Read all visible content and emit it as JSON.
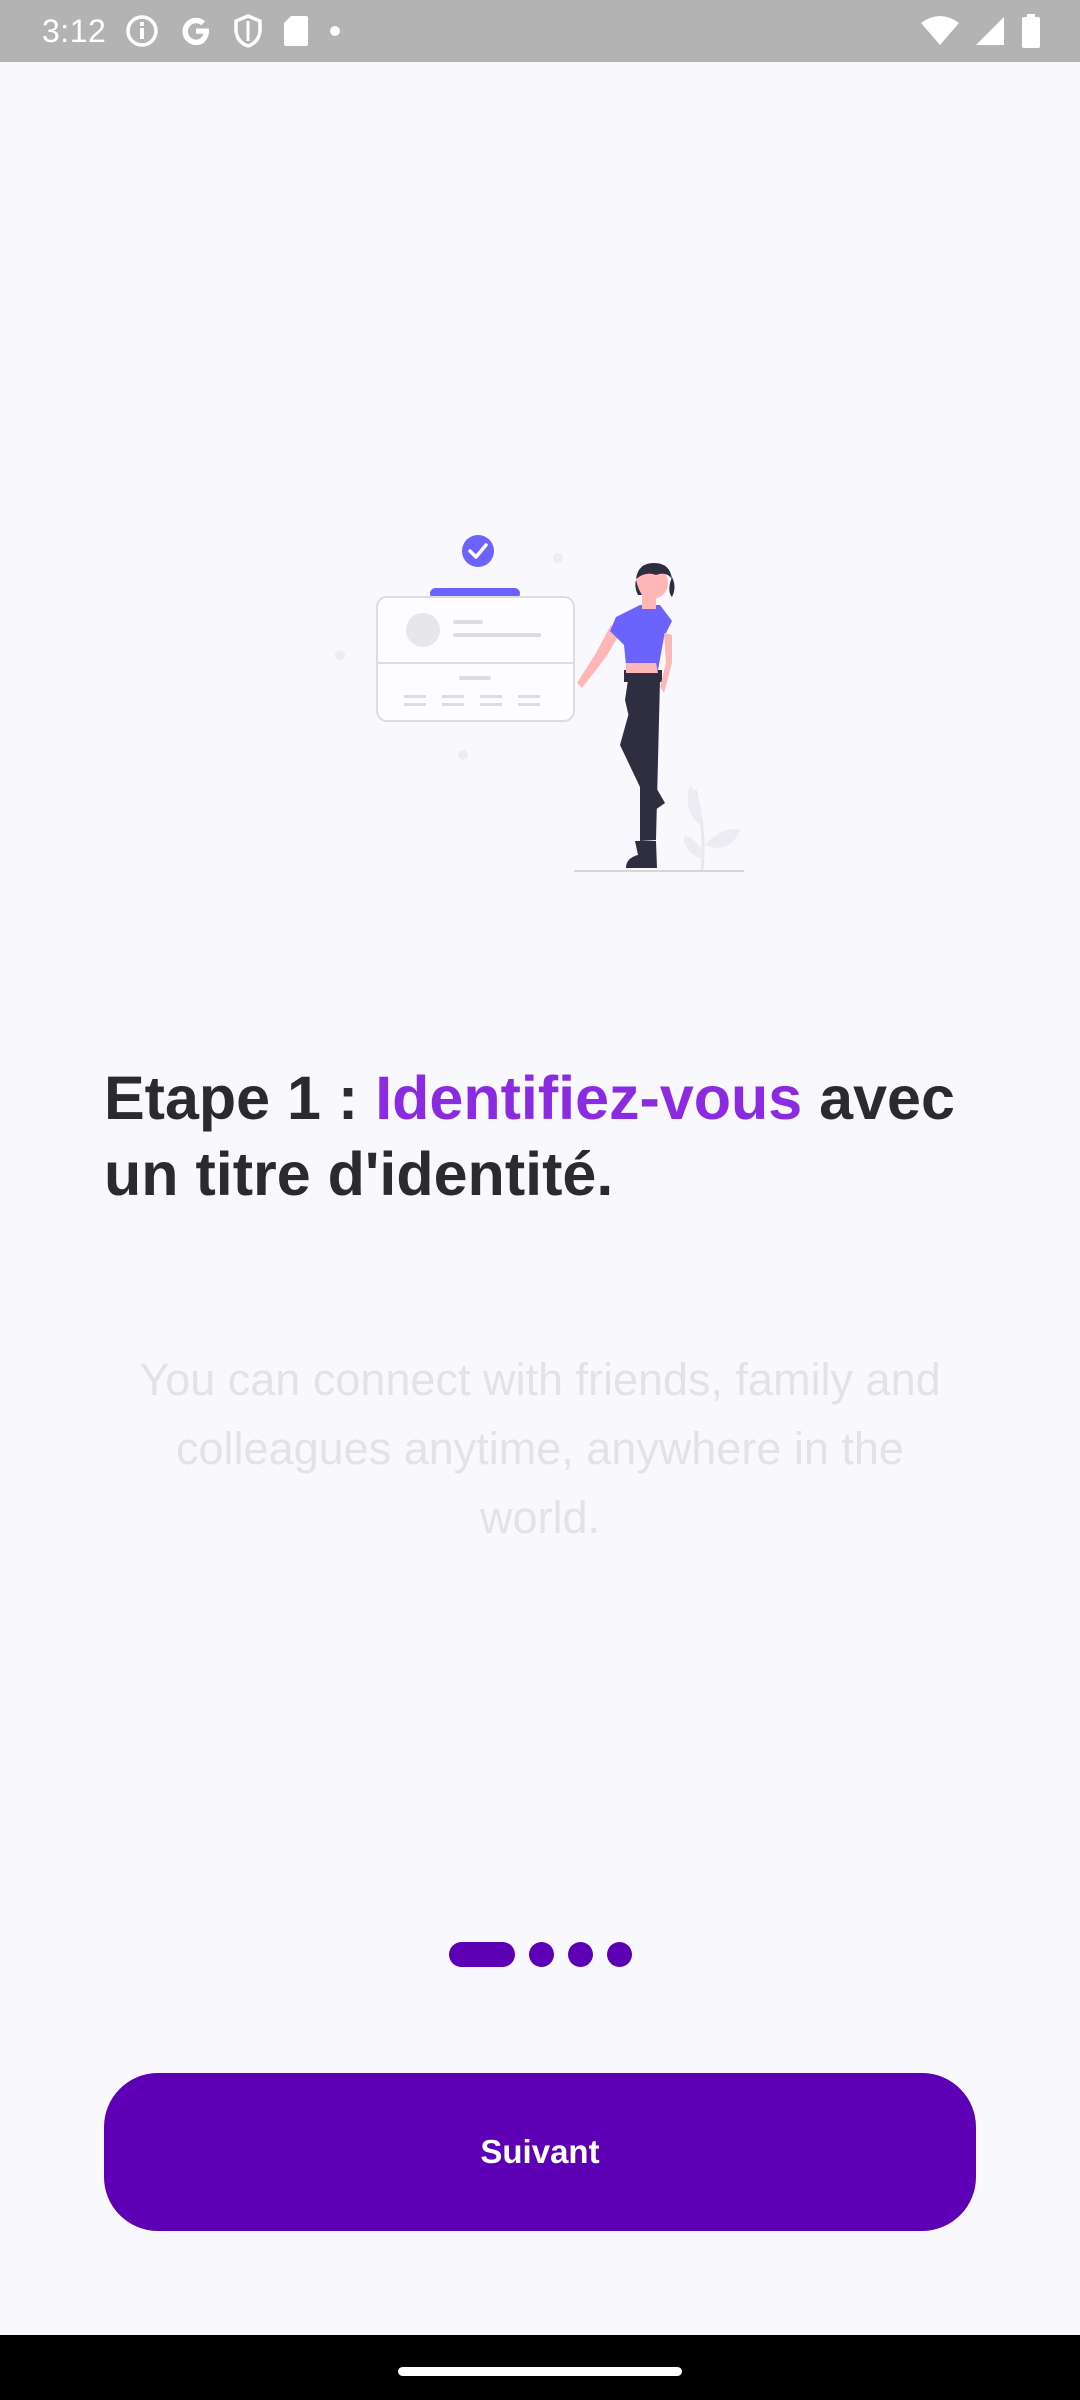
{
  "status_bar": {
    "time": "3:12",
    "left_icons": [
      "info-icon",
      "google-icon",
      "shield-icon",
      "sd-card-icon",
      "dot-icon"
    ],
    "right_icons": [
      "wifi-icon",
      "signal-icon",
      "battery-icon"
    ]
  },
  "onboarding": {
    "heading_prefix": "Etape 1 : ",
    "heading_accent": "Identifiez-vous",
    "heading_suffix": " avec un titre d'identité.",
    "description": "You can connect with friends, family and colleagues anytime, anywhere in the world.",
    "pager": {
      "total": 4,
      "current": 1
    },
    "next_label": "Suivant"
  },
  "colors": {
    "primary": "#5d00b5",
    "accent": "#8a2be2",
    "heading": "#2b2b2f",
    "illustration_accent": "#6c63ff"
  }
}
